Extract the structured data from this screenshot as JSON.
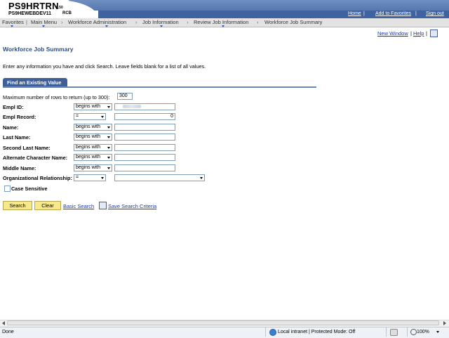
{
  "header": {
    "app_title": "PS9HRTRN",
    "version": "8.50",
    "database": "PS9HEWEBDEV11",
    "user": "RCB",
    "links": [
      "Home",
      "Add to Favorites",
      "Sign out"
    ]
  },
  "nav": {
    "items": [
      "Favorites",
      "Main Menu",
      "Workforce Administration",
      "Job Information",
      "Review Job Information",
      "Workforce Job Summary"
    ],
    "separator": "›"
  },
  "page_links": {
    "new_window": "New Window",
    "help": "Help",
    "sep": "|"
  },
  "page": {
    "title": "Workforce Job Summary",
    "instructions": "Enter any information you have and click Search. Leave fields blank for a list of all values.",
    "tab": "Find an Existing Value"
  },
  "form": {
    "max_rows_label": "Maximum number of rows to return (up to 300):",
    "max_rows_value": "300",
    "fields": [
      {
        "label": "Empl ID:",
        "operator": "begins with",
        "value": ""
      },
      {
        "label": "Empl Record:",
        "operator": "=",
        "value": "0"
      },
      {
        "label": "Name:",
        "operator": "begins with",
        "value": ""
      },
      {
        "label": "Last Name:",
        "operator": "begins with",
        "value": ""
      },
      {
        "label": "Second Last Name:",
        "operator": "begins with",
        "value": ""
      },
      {
        "label": "Alternate Character Name:",
        "operator": "begins with",
        "value": ""
      },
      {
        "label": "Middle Name:",
        "operator": "begins with",
        "value": ""
      },
      {
        "label": "Organizational Relationship:",
        "operator": "=",
        "value": ""
      }
    ],
    "case_sensitive_label": "Case Sensitive",
    "case_sensitive_checked": false
  },
  "actions": {
    "search": "Search",
    "clear": "Clear",
    "basic_search": "Basic Search",
    "save_search": "Save Search Criteria"
  },
  "status": {
    "left": "Done",
    "zone": "Local intranet | Protected Mode: Off",
    "zoom": "100%"
  },
  "colors": {
    "header_band": "#5678b0",
    "link": "#1a35b0",
    "title": "#2b4f8a",
    "tab": "#3e5f98",
    "button": "#f7e88c"
  }
}
